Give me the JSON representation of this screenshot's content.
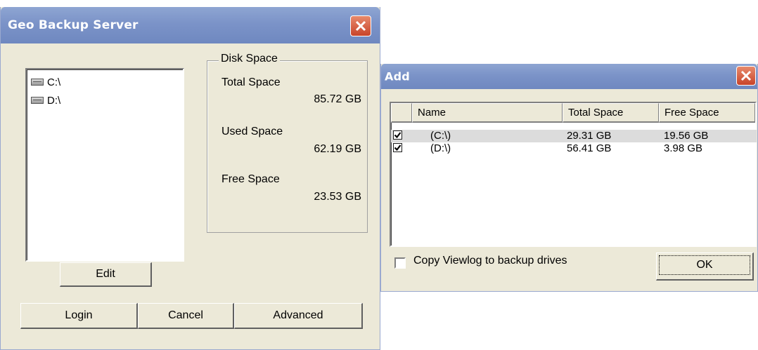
{
  "geo_window": {
    "title": "Geo Backup Server",
    "drives": [
      {
        "label": "C:\\"
      },
      {
        "label": "D:\\"
      }
    ],
    "disk_space": {
      "legend": "Disk Space",
      "total_label": "Total Space",
      "total_value": "85.72 GB",
      "used_label": "Used Space",
      "used_value": "62.19 GB",
      "free_label": "Free Space",
      "free_value": "23.53 GB"
    },
    "buttons": {
      "edit": "Edit",
      "login": "Login",
      "cancel": "Cancel",
      "advanced": "Advanced"
    }
  },
  "add_window": {
    "title": "Add",
    "columns": [
      "",
      "Name",
      "Total Space",
      "Free Space"
    ],
    "rows": [
      {
        "checked": true,
        "name": "(C:\\)",
        "total": "29.31 GB",
        "free": "19.56 GB",
        "selected": true
      },
      {
        "checked": true,
        "name": "(D:\\)",
        "total": "56.41 GB",
        "free": "3.98 GB",
        "selected": false
      }
    ],
    "copy_checkbox_label": "Copy Viewlog to backup drives",
    "copy_checked": false,
    "ok_label": "OK"
  },
  "icons": {
    "close": "close-icon",
    "drive": "hard-drive-icon",
    "check": "checkmark-icon"
  },
  "colors": {
    "titlebar": "#7b93c8",
    "window_bg": "#ece9d8",
    "close_button": "#d0573a",
    "selected_row": "#dcdcdc"
  }
}
